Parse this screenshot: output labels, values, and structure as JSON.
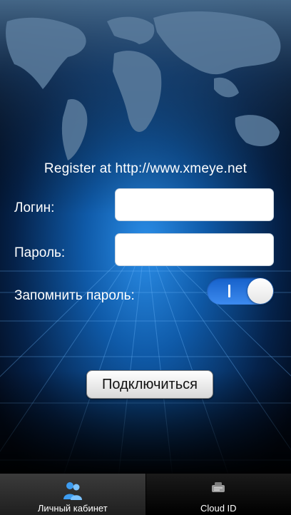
{
  "register_text": "Register at http://www.xmeye.net",
  "form": {
    "login_label": "Логин:",
    "login_value": "",
    "password_label": "Пароль:",
    "password_value": "",
    "remember_label": "Запомнить пароль:",
    "remember_on": true
  },
  "connect_label": "Подключиться",
  "tabs": [
    {
      "label": "Личный кабинет",
      "icon": "users-icon",
      "selected": true
    },
    {
      "label": "Cloud ID",
      "icon": "cloud-device-icon",
      "selected": false
    }
  ],
  "colors": {
    "toggle_accent": "#2f7fe8",
    "background": "#0a2f64"
  }
}
